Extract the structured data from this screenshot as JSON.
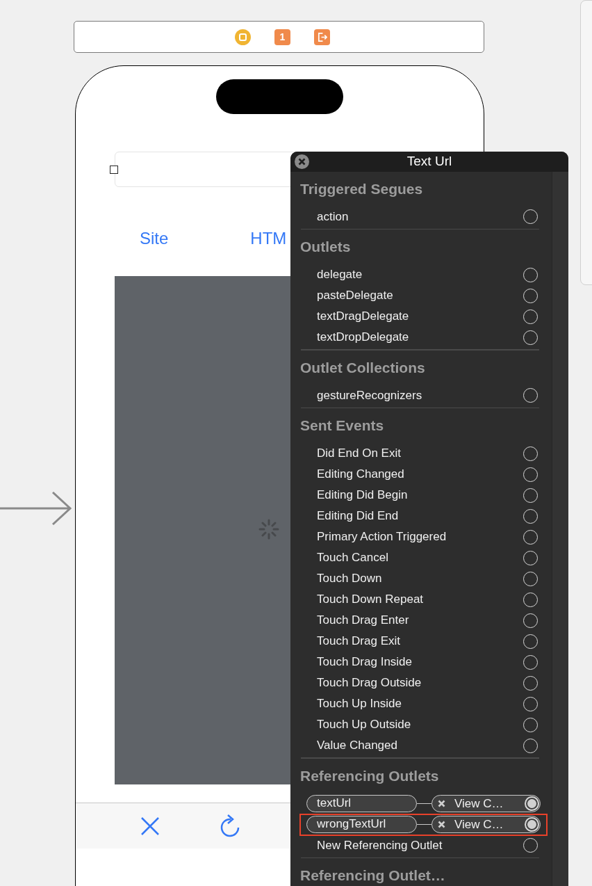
{
  "scene_bar": {
    "badge": "1"
  },
  "phone": {
    "segments": [
      {
        "label": "Site"
      },
      {
        "label": "HTM"
      }
    ]
  },
  "popup": {
    "title": "Text Url",
    "sections": [
      {
        "title": "Triggered Segues",
        "rows": [
          {
            "kind": "plain",
            "label": "action"
          }
        ]
      },
      {
        "title": "Outlets",
        "rows": [
          {
            "kind": "plain",
            "label": "delegate"
          },
          {
            "kind": "plain",
            "label": "pasteDelegate"
          },
          {
            "kind": "plain",
            "label": "textDragDelegate"
          },
          {
            "kind": "plain",
            "label": "textDropDelegate"
          }
        ]
      },
      {
        "title": "Outlet Collections",
        "rows": [
          {
            "kind": "plain",
            "label": "gestureRecognizers"
          }
        ]
      },
      {
        "title": "Sent Events",
        "rows": [
          {
            "kind": "plain",
            "label": "Did End On Exit"
          },
          {
            "kind": "plain",
            "label": "Editing Changed"
          },
          {
            "kind": "plain",
            "label": "Editing Did Begin"
          },
          {
            "kind": "plain",
            "label": "Editing Did End"
          },
          {
            "kind": "plain",
            "label": "Primary Action Triggered"
          },
          {
            "kind": "plain",
            "label": "Touch Cancel"
          },
          {
            "kind": "plain",
            "label": "Touch Down"
          },
          {
            "kind": "plain",
            "label": "Touch Down Repeat"
          },
          {
            "kind": "plain",
            "label": "Touch Drag Enter"
          },
          {
            "kind": "plain",
            "label": "Touch Drag Exit"
          },
          {
            "kind": "plain",
            "label": "Touch Drag Inside"
          },
          {
            "kind": "plain",
            "label": "Touch Drag Outside"
          },
          {
            "kind": "plain",
            "label": "Touch Up Inside"
          },
          {
            "kind": "plain",
            "label": "Touch Up Outside"
          },
          {
            "kind": "plain",
            "label": "Value Changed"
          }
        ]
      },
      {
        "title": "Referencing Outlets",
        "rows": [
          {
            "kind": "connection",
            "label": "textUrl",
            "target": "View C…",
            "highlighted": false
          },
          {
            "kind": "connection",
            "label": "wrongTextUrl",
            "target": "View C…",
            "highlighted": true
          },
          {
            "kind": "plain",
            "label": "New Referencing Outlet"
          }
        ]
      },
      {
        "title": "Referencing Outlet…"
      }
    ]
  }
}
